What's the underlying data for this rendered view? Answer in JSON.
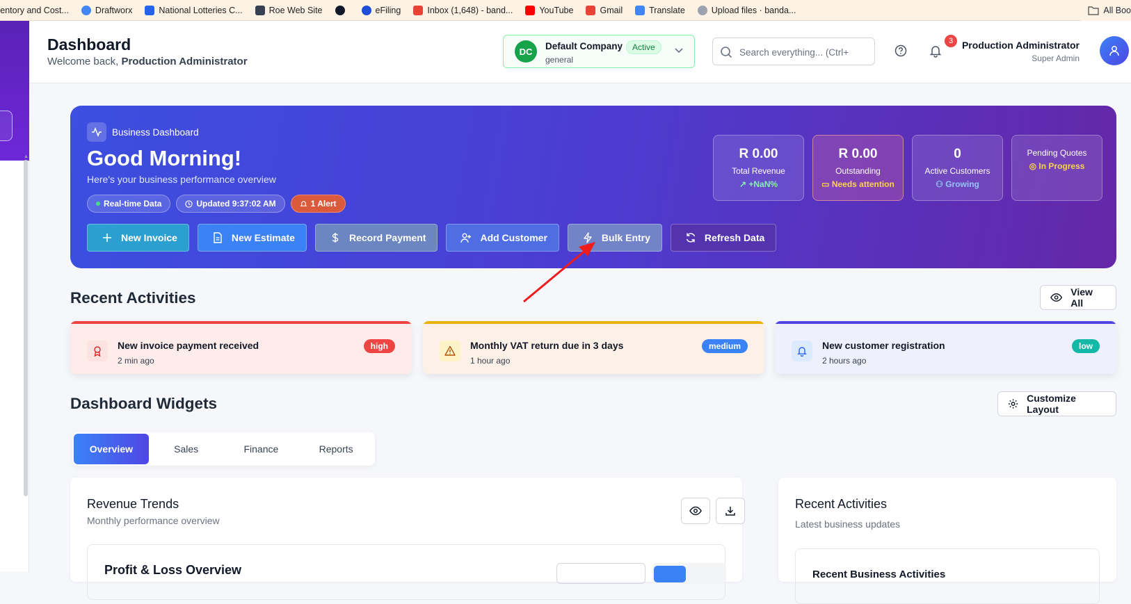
{
  "bookmarks": [
    {
      "label": "ventory and Cost...",
      "icon": "document-icon",
      "color": "#6b7280"
    },
    {
      "label": "Draftworx",
      "icon": "chrome-icon",
      "color": "#4285f4"
    },
    {
      "label": "National Lotteries C...",
      "icon": "flag-icon",
      "color": "#2563eb"
    },
    {
      "label": "Roe Web Site",
      "icon": "chart-icon",
      "color": "#374151"
    },
    {
      "label": "",
      "icon": "globe-icon",
      "color": "#111827"
    },
    {
      "label": "eFiling",
      "icon": "efiling-icon",
      "color": "#1d4ed8"
    },
    {
      "label": "Inbox (1,648) - band...",
      "icon": "gmail-icon",
      "color": "#ea4335"
    },
    {
      "label": "YouTube",
      "icon": "youtube-icon",
      "color": "#ff0000"
    },
    {
      "label": "Gmail",
      "icon": "gmail-icon",
      "color": "#ea4335"
    },
    {
      "label": "Translate",
      "icon": "translate-icon",
      "color": "#4285f4"
    },
    {
      "label": "Upload files · banda...",
      "icon": "github-icon",
      "color": "#9ca3af"
    }
  ],
  "bookmarks_right": "All Boo",
  "header": {
    "title": "Dashboard",
    "welcome_prefix": "Welcome back, ",
    "welcome_name": "Production Administrator",
    "company": {
      "initials": "DC",
      "name": "Default Company",
      "status": "Active",
      "sub": "general"
    },
    "search_placeholder": "Search everything... (Ctrl+",
    "notifications": "3",
    "user_name": "Production Administrator",
    "user_role": "Super Admin"
  },
  "hero": {
    "tag": "Business Dashboard",
    "greeting": "Good Morning!",
    "subtitle": "Here's your business performance overview",
    "chips": {
      "realtime": "Real-time Data",
      "updated": "Updated 9:37:02 AM",
      "alert": "1 Alert"
    },
    "actions": [
      {
        "label": "New Invoice",
        "icon": "plus-icon",
        "bg": "#2a9fd0"
      },
      {
        "label": "New Estimate",
        "icon": "document-icon",
        "bg": "#3b82f6"
      },
      {
        "label": "Record Payment",
        "icon": "dollar-icon",
        "bg": "#6b86c0"
      },
      {
        "label": "Add Customer",
        "icon": "user-plus-icon",
        "bg": "#4f6ee3"
      },
      {
        "label": "Bulk Entry",
        "icon": "bolt-icon",
        "bg": "#7283c8"
      },
      {
        "label": "Refresh Data",
        "icon": "refresh-icon",
        "bg": "#5334ae"
      }
    ],
    "stats": [
      {
        "value": "R 0.00",
        "label": "Total Revenue",
        "sub": "+NaN%",
        "sub_color": "#86efac"
      },
      {
        "value": "R 0.00",
        "label": "Outstanding",
        "sub": "Needs attention",
        "sub_color": "#fcd34d"
      },
      {
        "value": "0",
        "label": "Active Customers",
        "sub": "Growing",
        "sub_color": "#93c5fd"
      },
      {
        "value": "",
        "label": "Pending Quotes",
        "sub": "In Progress",
        "sub_color": "#fcd34d"
      }
    ]
  },
  "recent": {
    "title": "Recent Activities",
    "view_all": "View All",
    "items": [
      {
        "title": "New invoice payment received",
        "time": "2 min ago",
        "priority": "high",
        "bar": "#ef4444",
        "bg": "#fdecea",
        "badge": "#ef4444",
        "icon_bg": "#fde2e2",
        "icon_color": "#dc2626"
      },
      {
        "title": "Monthly VAT return due in 3 days",
        "time": "1 hour ago",
        "priority": "medium",
        "bar": "#eab308",
        "bg": "#fdf1e7",
        "badge": "#3b82f6",
        "icon_bg": "#fef3c7",
        "icon_color": "#b45309"
      },
      {
        "title": "New customer registration",
        "time": "2 hours ago",
        "priority": "low",
        "bar": "#4f46e5",
        "bg": "#eef0fb",
        "badge": "#14b8a6",
        "icon_bg": "#dbeafe",
        "icon_color": "#2563eb"
      }
    ]
  },
  "widgets": {
    "title": "Dashboard Widgets",
    "customize": "Customize Layout",
    "tabs": [
      "Overview",
      "Sales",
      "Finance",
      "Reports"
    ],
    "active_tab": "Overview"
  },
  "revenue": {
    "title": "Revenue Trends",
    "subtitle": "Monthly performance overview",
    "inner_title": "Profit & Loss Overview"
  },
  "activities_panel": {
    "title": "Recent Activities",
    "subtitle": "Latest business updates",
    "inner_title": "Recent Business Activities"
  }
}
